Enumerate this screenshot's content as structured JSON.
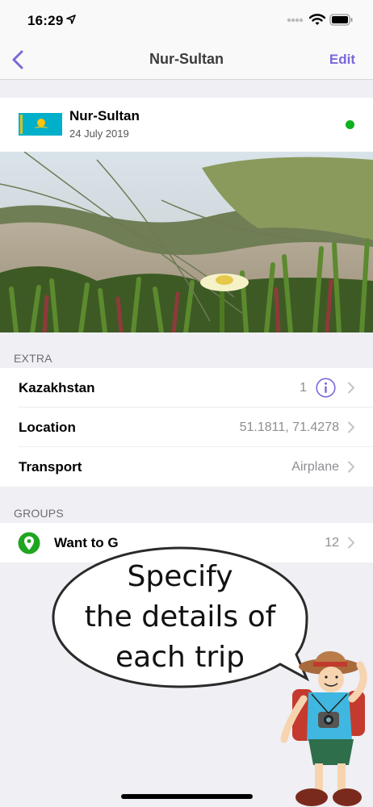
{
  "status_bar": {
    "time": "16:29"
  },
  "nav": {
    "title": "Nur-Sultan",
    "edit_label": "Edit"
  },
  "trip": {
    "title": "Nur-Sultan",
    "date": "24 July 2019",
    "status_color": "#0cb021"
  },
  "extra": {
    "header": "EXTRA",
    "rows": [
      {
        "label": "Kazakhstan",
        "value": "1"
      },
      {
        "label": "Location",
        "value": "51.1811, 71.4278"
      },
      {
        "label": "Transport",
        "value": "Airplane"
      }
    ]
  },
  "groups": {
    "header": "GROUPS",
    "rows": [
      {
        "label": "Want to G",
        "value": "12",
        "icon": "map-pin-icon"
      }
    ]
  },
  "promo": {
    "line1": "Specify",
    "line2": "the details of",
    "line3": "each trip"
  },
  "colors": {
    "accent": "#7b68d8",
    "status_green": "#0cb021"
  }
}
